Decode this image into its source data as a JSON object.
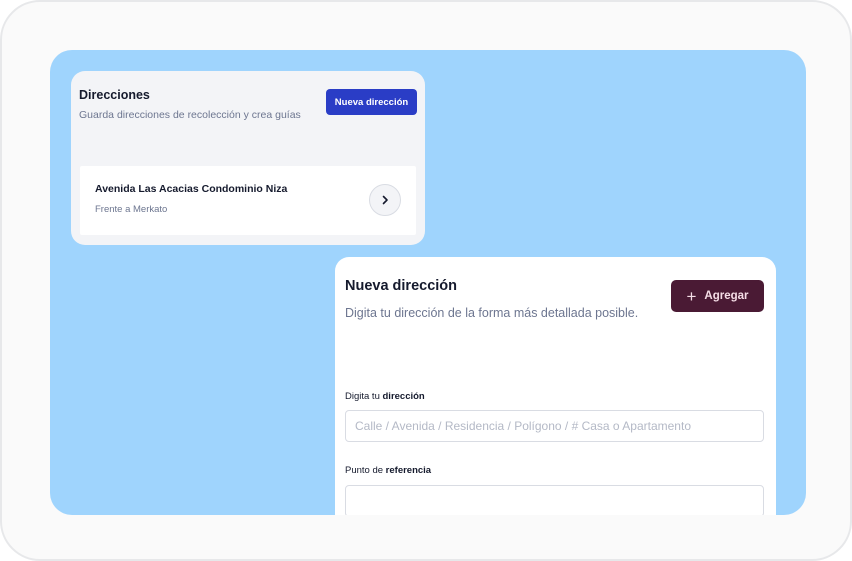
{
  "address_list": {
    "title": "Direcciones",
    "subtitle": "Guarda direcciones de recolección y crea guías",
    "new_button_label": "Nueva dirección",
    "items": [
      {
        "name": "Avenida Las Acacias Condominio Niza",
        "reference": "Frente a Merkato"
      }
    ]
  },
  "new_address_form": {
    "title": "Nueva dirección",
    "subtitle": "Digita tu dirección de la forma más detallada posible.",
    "add_button_label": "Agregar",
    "address_field": {
      "label_prefix": "Digita tu ",
      "label_bold": "dirección",
      "placeholder": "Calle / Avenida / Residencia / Polígono / # Casa o Apartamento",
      "value": ""
    },
    "reference_field": {
      "label_prefix": "Punto de ",
      "label_bold": "referencia",
      "placeholder": "",
      "value": ""
    }
  },
  "colors": {
    "background_panel": "#9fd4fd",
    "primary_button": "#2a3dc6",
    "add_button": "#4a1a34",
    "text_primary": "#151a2d",
    "text_secondary": "#6d7690"
  },
  "icons": {
    "chevron": "chevron-right-icon",
    "plus": "plus-icon"
  }
}
